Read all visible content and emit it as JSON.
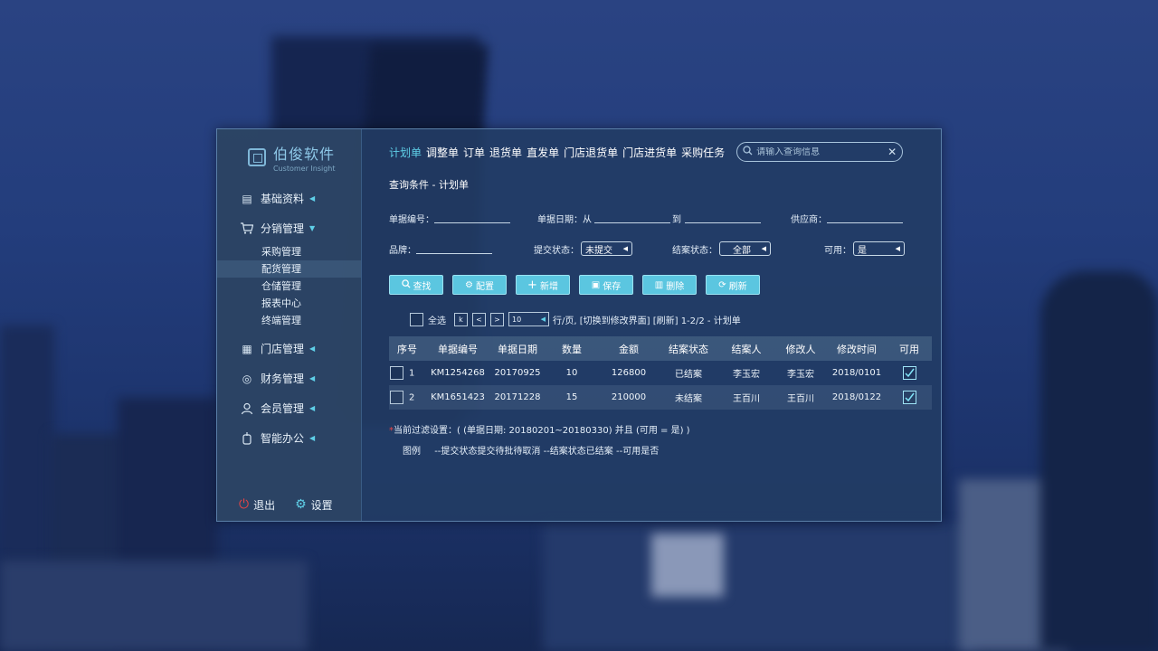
{
  "app": {
    "title": "伯俊软件",
    "subtitle": "Customer Insight"
  },
  "sidebar": {
    "items": [
      {
        "label": "基础资料",
        "icon": "document-icon"
      },
      {
        "label": "分销管理",
        "icon": "cart-icon"
      },
      {
        "label": "门店管理",
        "icon": "store-icon"
      },
      {
        "label": "财务管理",
        "icon": "finance-icon"
      },
      {
        "label": "会员管理",
        "icon": "member-icon"
      },
      {
        "label": "智能办公",
        "icon": "office-icon"
      }
    ],
    "submenu": [
      "采购管理",
      "配货管理",
      "仓储管理",
      "报表中心",
      "终端管理"
    ],
    "logout": "退出",
    "settings": "设置"
  },
  "tabs": [
    "计划单",
    "调整单",
    "订单",
    "退货单",
    "直发单",
    "门店退货单",
    "门店进货单",
    "采购任务"
  ],
  "search": {
    "placeholder": "请输入查询信息"
  },
  "query": {
    "title": "查询条件 - 计划单",
    "bill_no_label": "单据编号：",
    "bill_date_label": "单据日期：从",
    "to_label": "到",
    "supplier_label": "供应商：",
    "brand_label": "品牌：",
    "submit_status_label": "提交状态：",
    "submit_status_value": "未提交",
    "close_status_label": "结案状态：",
    "close_status_value": "全部",
    "available_label": "可用：",
    "available_value": "是"
  },
  "buttons": {
    "search": "查找",
    "config": "配置",
    "add": "新增",
    "save": "保存",
    "delete": "删除",
    "refresh": "刷新"
  },
  "pager": {
    "select_all": "全选",
    "first": "k",
    "prev": "<",
    "next": ">",
    "page_size": "10",
    "info": "行/页, [切换到修改界面] [刷新] 1-2/2  - 计划单"
  },
  "table": {
    "headers": [
      "序号",
      "单据编号",
      "单据日期",
      "数量",
      "金额",
      "结案状态",
      "结案人",
      "修改人",
      "修改时间",
      "可用"
    ],
    "rows": [
      {
        "no": "1",
        "bill": "KM1254268",
        "date": "20170925",
        "qty": "10",
        "amount": "126800",
        "status": "已结案",
        "closer": "李玉宏",
        "modifier": "李玉宏",
        "mtime": "2018/0101",
        "checked": true
      },
      {
        "no": "2",
        "bill": "KM1651423",
        "date": "20171228",
        "qty": "15",
        "amount": "210000",
        "status": "未结案",
        "closer": "王百川",
        "modifier": "王百川",
        "mtime": "2018/0122",
        "checked": true
      }
    ]
  },
  "note": {
    "star": "*",
    "text": "当前过滤设置：( (单据日期: 20180201~20180330) 并且 (可用 = 是) )"
  },
  "legend": {
    "title": "图例",
    "text": "--提交状态提交待批待取消 --结案状态已结案 --可用是否"
  },
  "colors": {
    "accent": "#5fd0e8",
    "button": "#5bc6e0",
    "danger": "#e84545"
  }
}
